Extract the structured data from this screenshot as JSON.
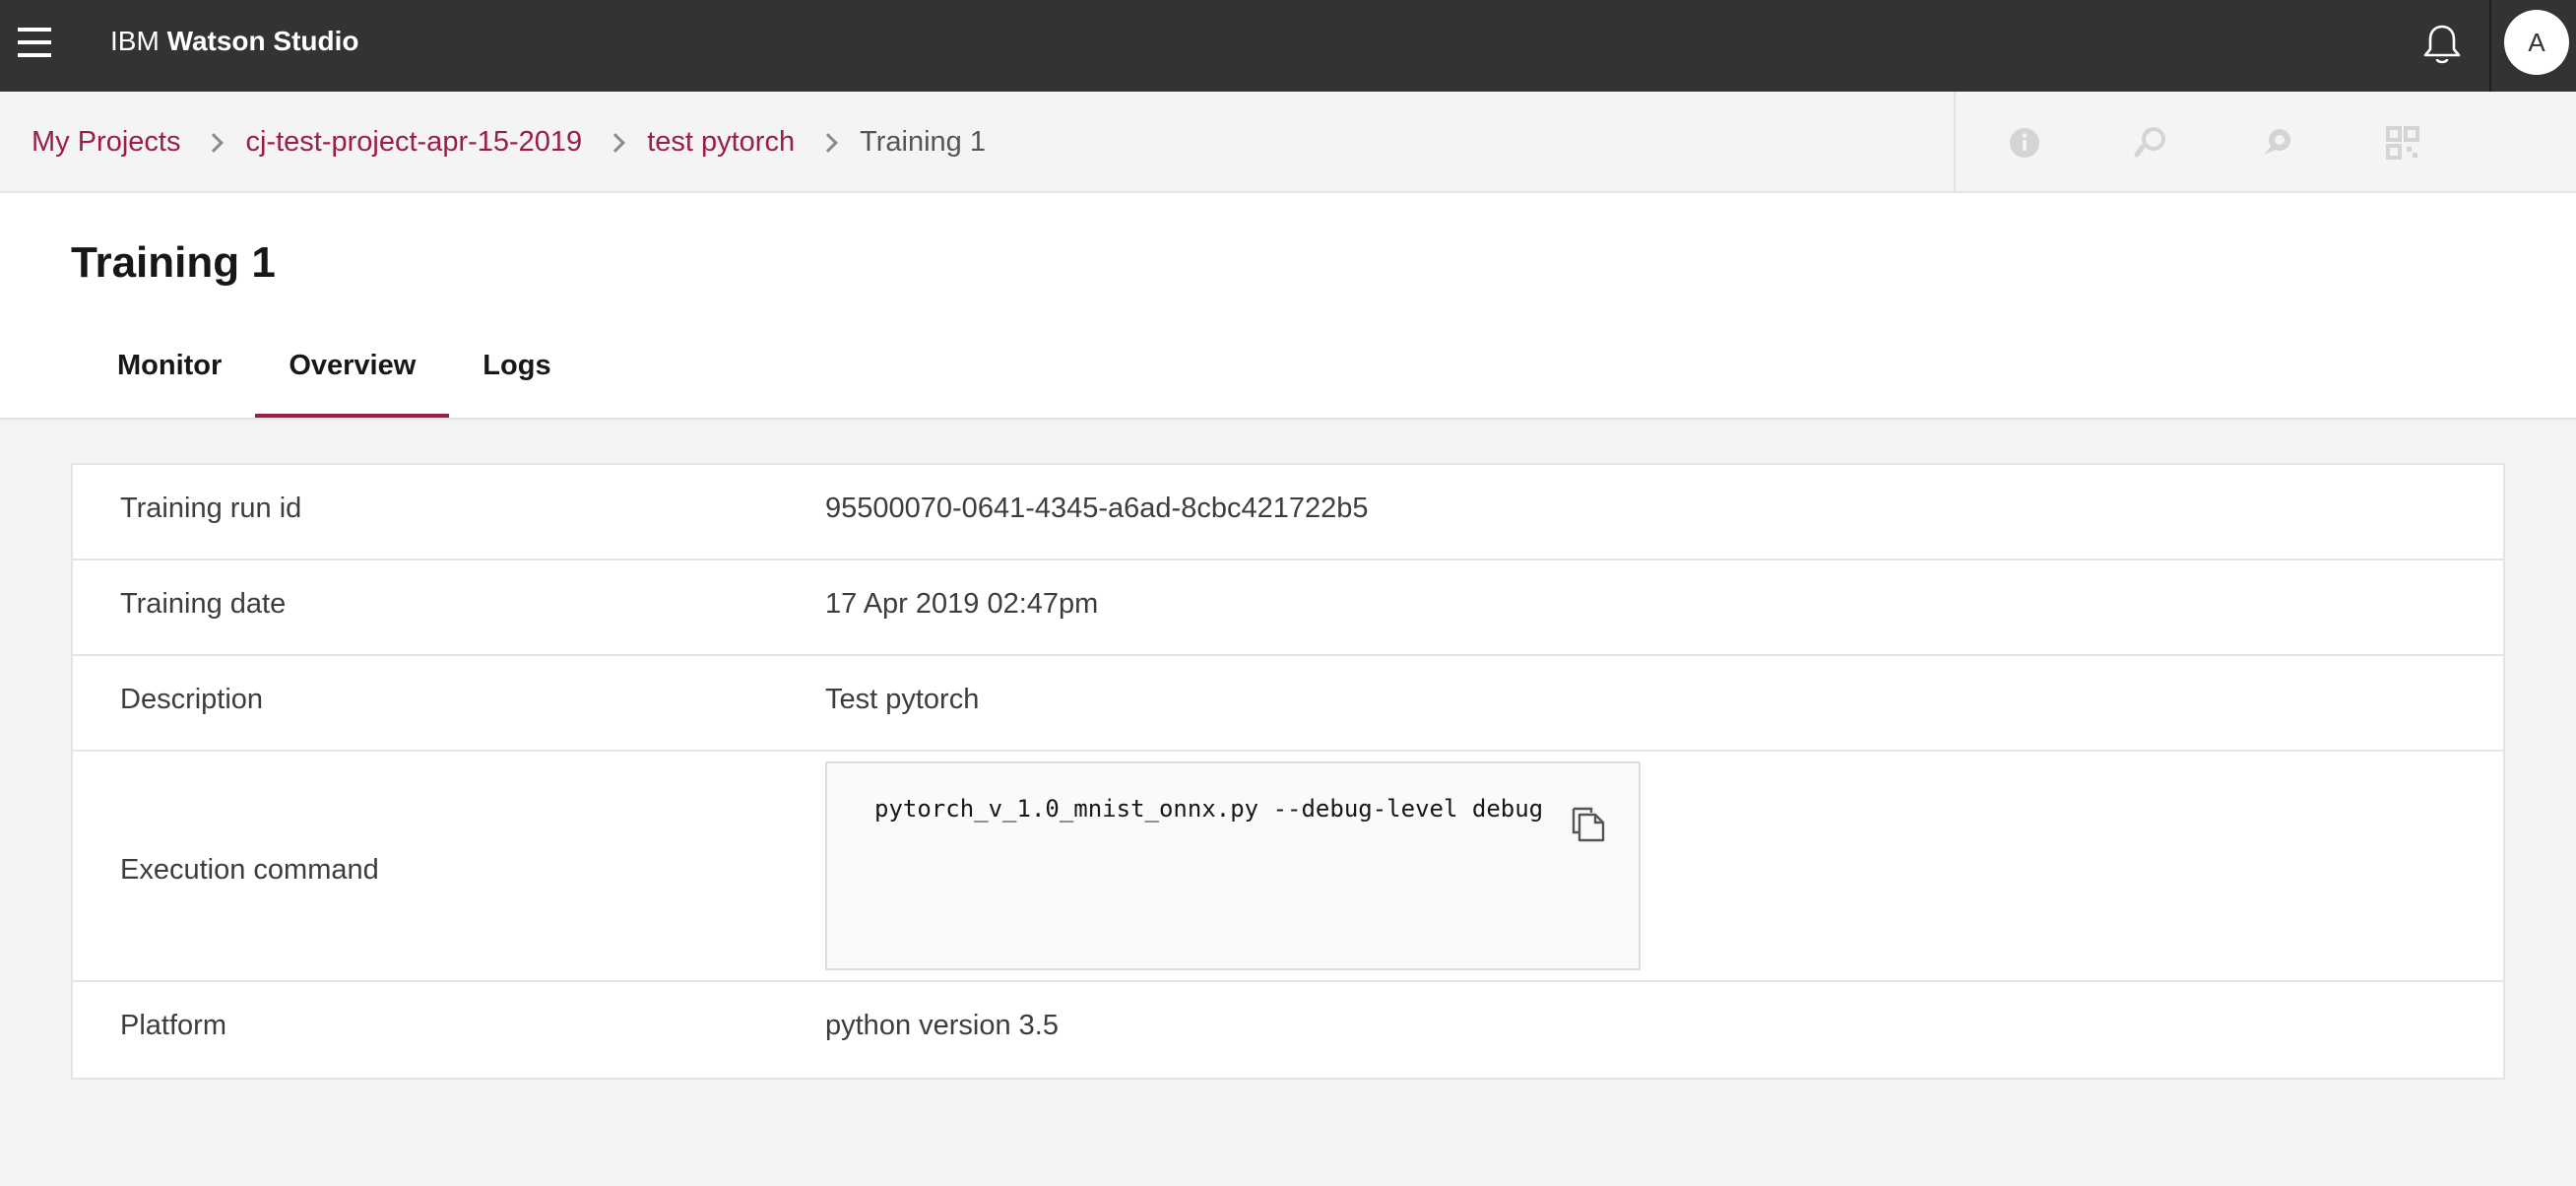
{
  "app": {
    "brand_prefix": "IBM",
    "brand_name": "Watson Studio",
    "avatar_initial": "A"
  },
  "breadcrumb": {
    "items": [
      {
        "label": "My Projects"
      },
      {
        "label": "cj-test-project-apr-15-2019"
      },
      {
        "label": "test pytorch"
      },
      {
        "label": "Training 1"
      }
    ]
  },
  "toolbar_icons": [
    "info-icon",
    "refresh-search-icon",
    "chat-icon",
    "grid-qr-icon"
  ],
  "page": {
    "title": "Training 1",
    "tabs": [
      {
        "label": "Monitor",
        "active": false
      },
      {
        "label": "Overview",
        "active": true
      },
      {
        "label": "Logs",
        "active": false
      }
    ]
  },
  "details": {
    "run_id": {
      "label": "Training run id",
      "value": "95500070-0641-4345-a6ad-8cbc421722b5"
    },
    "date": {
      "label": "Training date",
      "value": "17 Apr 2019 02:47pm"
    },
    "description": {
      "label": "Description",
      "value": "Test pytorch"
    },
    "command": {
      "label": "Execution command",
      "value": "pytorch_v_1.0_mnist_onnx.py --debug-level debug"
    },
    "platform": {
      "label": "Platform",
      "value": "python version 3.5"
    }
  },
  "colors": {
    "topbar": "#333333",
    "accent": "#9b1d4d",
    "background": "#f3f3f3"
  }
}
